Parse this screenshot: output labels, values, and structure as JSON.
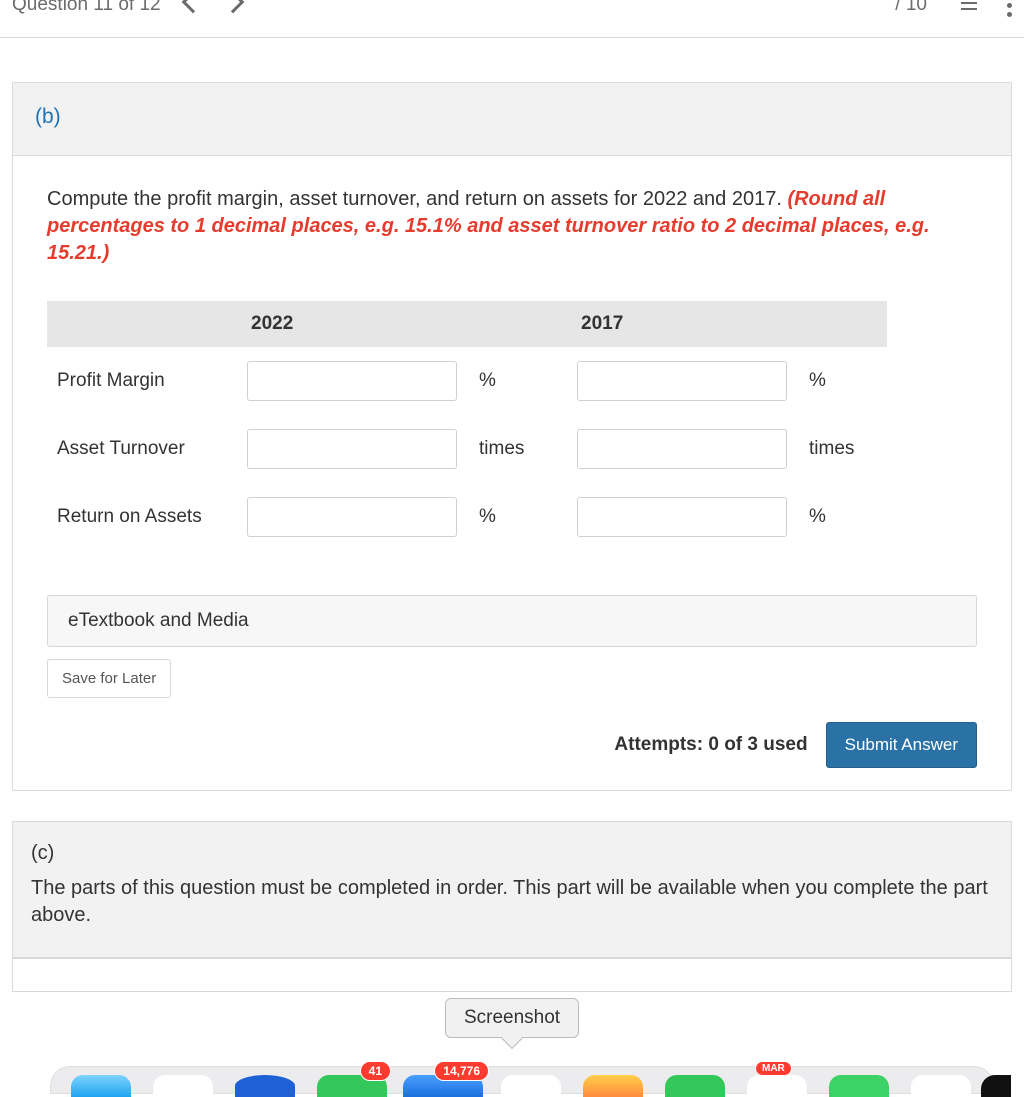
{
  "topbar": {
    "question_label": "Question 11 of 12",
    "progress": "/ 10"
  },
  "partB": {
    "label": "(b)",
    "prompt_plain": "Compute the profit margin, asset turnover, and return on assets for 2022 and 2017. ",
    "prompt_red": "(Round all percentages to 1 decimal places, e.g. 15.1% and asset turnover ratio to 2 decimal places, e.g. 15.21.)",
    "table": {
      "col1": "2022",
      "col2": "2017",
      "rows": [
        {
          "label": "Profit Margin",
          "unit2022": "%",
          "unit2017": "%"
        },
        {
          "label": "Asset Turnover",
          "unit2022": "times",
          "unit2017": "times"
        },
        {
          "label": "Return on Assets",
          "unit2022": "%",
          "unit2017": "%"
        }
      ]
    },
    "etextbook_label": "eTextbook and Media",
    "save_label": "Save for Later",
    "attempts_text": "Attempts: 0 of 3 used",
    "submit_label": "Submit Answer"
  },
  "partC": {
    "label": "(c)",
    "locked_text": "The parts of this question must be completed in order. This part will be available when you complete the part above."
  },
  "tooltip": "Screenshot",
  "dock": {
    "badges": {
      "messages": "41",
      "mail": "14,776",
      "calendar": "MAR"
    }
  }
}
